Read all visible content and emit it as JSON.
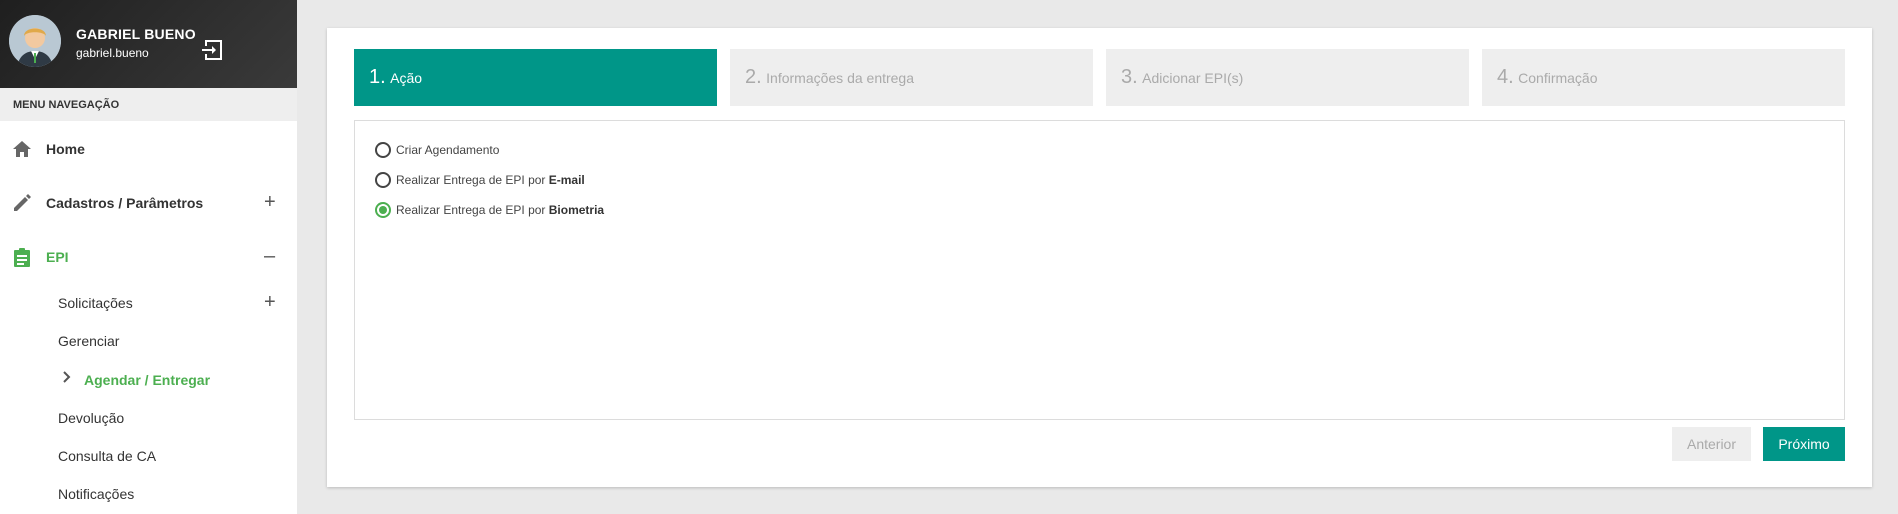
{
  "user": {
    "name": "GABRIEL BUENO",
    "login": "gabriel.bueno"
  },
  "menu": {
    "header": "MENU NAVEGAÇÃO",
    "items": [
      {
        "label": "Home",
        "icon": "home-icon",
        "toggle": ""
      },
      {
        "label": "Cadastros / Parâmetros",
        "icon": "pencil-icon",
        "toggle": "+"
      },
      {
        "label": "EPI",
        "icon": "clipboard-icon",
        "toggle": "–",
        "active": true
      }
    ],
    "epi_submenu": [
      {
        "label": "Solicitações",
        "toggle": "+"
      },
      {
        "label": "Gerenciar"
      },
      {
        "label": "Agendar / Entregar",
        "active": true
      },
      {
        "label": "Devolução"
      },
      {
        "label": "Consulta de CA"
      },
      {
        "label": "Notificações"
      }
    ]
  },
  "wizard": {
    "steps": [
      {
        "num": "1.",
        "label": "Ação",
        "active": true
      },
      {
        "num": "2.",
        "label": "Informações da entrega"
      },
      {
        "num": "3.",
        "label": "Adicionar EPI(s)"
      },
      {
        "num": "4.",
        "label": "Confirmação"
      }
    ],
    "options": [
      {
        "prefix": "Criar Agendamento",
        "bold": "",
        "checked": false
      },
      {
        "prefix": "Realizar Entrega de EPI por ",
        "bold": "E-mail",
        "checked": false
      },
      {
        "prefix": "Realizar Entrega de EPI por ",
        "bold": "Biometria",
        "checked": true
      }
    ],
    "buttons": {
      "prev": "Anterior",
      "next": "Próximo"
    }
  },
  "colors": {
    "accent": "#009688",
    "active_green": "#4caf50",
    "step_inactive": "#eeeeee"
  }
}
